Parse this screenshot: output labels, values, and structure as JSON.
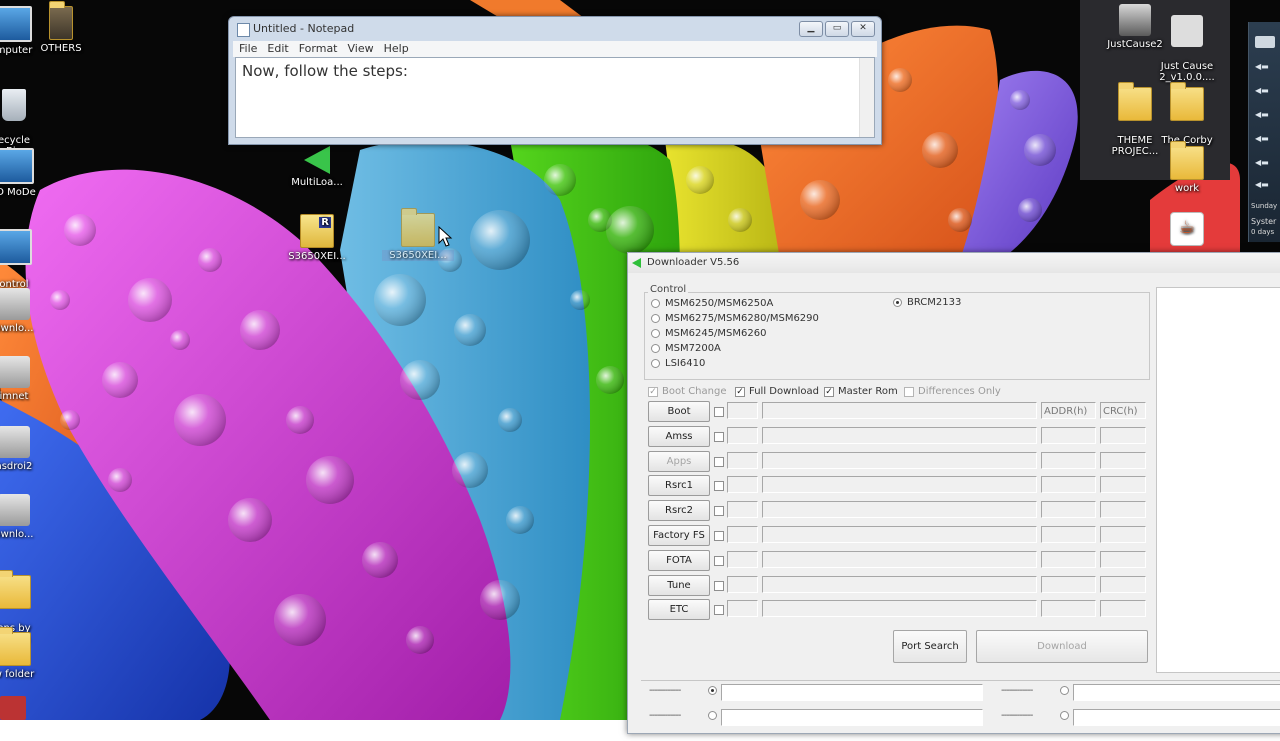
{
  "desktop": {
    "left_icons": [
      {
        "label": "mputer",
        "icon": "computer-icon"
      },
      {
        "label": "OTHERS",
        "icon": "folder-icon"
      },
      {
        "label": "ecycle\nBin",
        "icon": "recycle-bin-icon"
      },
      {
        "label": "D MoDe",
        "icon": "app-icon"
      },
      {
        "label": "ontrol\nPanel",
        "icon": "control-panel-icon"
      },
      {
        "label": "ownlo...",
        "icon": "app-icon"
      },
      {
        "label": "imnet",
        "icon": "app-icon"
      },
      {
        "label": "asdroi2",
        "icon": "app-icon"
      },
      {
        "label": "ownlo...",
        "icon": "app-icon"
      },
      {
        "label": "ons by\nristian",
        "icon": "folder-icon"
      },
      {
        "label": "w folder",
        "icon": "folder-icon"
      }
    ],
    "mid_icons": [
      {
        "label": "MultiLoa...",
        "icon": "green-arrow-icon"
      },
      {
        "label": "S3650XEI...",
        "icon": "winrar-archive-icon"
      },
      {
        "label": "S3650XEI...",
        "icon": "folder-icon"
      }
    ],
    "right_icons": [
      {
        "label": "JustCause2",
        "icon": "game-icon"
      },
      {
        "label": "Just Cause\n2_v1.0.0....",
        "icon": "game-icon"
      },
      {
        "label": "THEME\nPROJEC...",
        "icon": "folder-icon"
      },
      {
        "label": "The Corby\nWorld",
        "icon": "folder-icon"
      },
      {
        "label": "work",
        "icon": "folder-icon"
      },
      {
        "label": "",
        "icon": "java-icon"
      }
    ]
  },
  "sidebar": {
    "day": "Sunday",
    "label": "Syster",
    "sub": "0 days"
  },
  "notepad": {
    "title": "Untitled - Notepad",
    "menu": [
      "File",
      "Edit",
      "Format",
      "View",
      "Help"
    ],
    "text": "Now, follow the steps:"
  },
  "downloader": {
    "title": "Downloader V5.56",
    "control_label": "Control",
    "chipsets": [
      {
        "label": "MSM6250/MSM6250A",
        "selected": false
      },
      {
        "label": "MSM6275/MSM6280/MSM6290",
        "selected": false
      },
      {
        "label": "MSM6245/MSM6260",
        "selected": false
      },
      {
        "label": "MSM7200A",
        "selected": false
      },
      {
        "label": "LSI6410",
        "selected": false
      },
      {
        "label": "BRCM2133",
        "selected": true
      }
    ],
    "options": [
      {
        "label": "Boot Change",
        "checked": true,
        "disabled": true
      },
      {
        "label": "Full Download",
        "checked": true,
        "disabled": false
      },
      {
        "label": "Master Rom",
        "checked": true,
        "disabled": false
      },
      {
        "label": "Differences Only",
        "checked": false,
        "disabled": true
      }
    ],
    "addr_header": "ADDR(h)",
    "crc_header": "CRC(h)",
    "rows": [
      {
        "label": "Boot",
        "disabled": false
      },
      {
        "label": "Amss",
        "disabled": false
      },
      {
        "label": "Apps",
        "disabled": true
      },
      {
        "label": "Rsrc1",
        "disabled": false
      },
      {
        "label": "Rsrc2",
        "disabled": false
      },
      {
        "label": "Factory FS",
        "disabled": false
      },
      {
        "label": "FOTA",
        "disabled": false
      },
      {
        "label": "Tune",
        "disabled": false
      },
      {
        "label": "ETC",
        "disabled": false
      }
    ],
    "port_search_label": "Port Search",
    "download_label": "Download",
    "port_placeholder": "------------"
  },
  "colors": {
    "notepad_frame": "#cfdbea",
    "downloader_bg": "#f0f0f0",
    "accent_green": "#2fbf3a"
  }
}
